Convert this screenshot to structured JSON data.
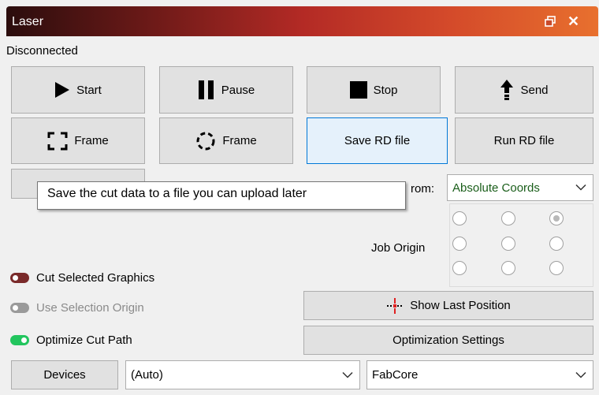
{
  "window": {
    "title": "Laser"
  },
  "status": "Disconnected",
  "buttons": {
    "start": "Start",
    "pause": "Pause",
    "stop": "Stop",
    "send": "Send",
    "frame_rect": "Frame",
    "frame_circle": "Frame",
    "save_rd": "Save RD file",
    "run_rd": "Run RD file",
    "show_last_position": "Show Last Position",
    "optimization_settings": "Optimization Settings",
    "devices": "Devices"
  },
  "start_from": {
    "label_visible": "rom:",
    "selected": "Absolute Coords"
  },
  "job_origin": {
    "label": "Job Origin",
    "selected_index": 2
  },
  "options": {
    "cut_selected_graphics": {
      "label": "Cut Selected Graphics",
      "enabled": false
    },
    "use_selection_origin": {
      "label": "Use Selection Origin",
      "enabled": false,
      "disabled": true
    },
    "optimize_cut_path": {
      "label": "Optimize Cut Path",
      "enabled": true
    }
  },
  "port_select": {
    "selected": "(Auto)"
  },
  "device_select": {
    "selected": "FabCore"
  },
  "tooltip": {
    "text": "Save the cut data to a file you can upload later"
  },
  "colors": {
    "accent": "#0078d7",
    "toggle_on": "#22c55e",
    "toggle_off": "#7a2a2a",
    "toggle_disabled": "#9a9a9a",
    "start_from_text": "#1a5e1a",
    "crosshair": "#e02020"
  }
}
